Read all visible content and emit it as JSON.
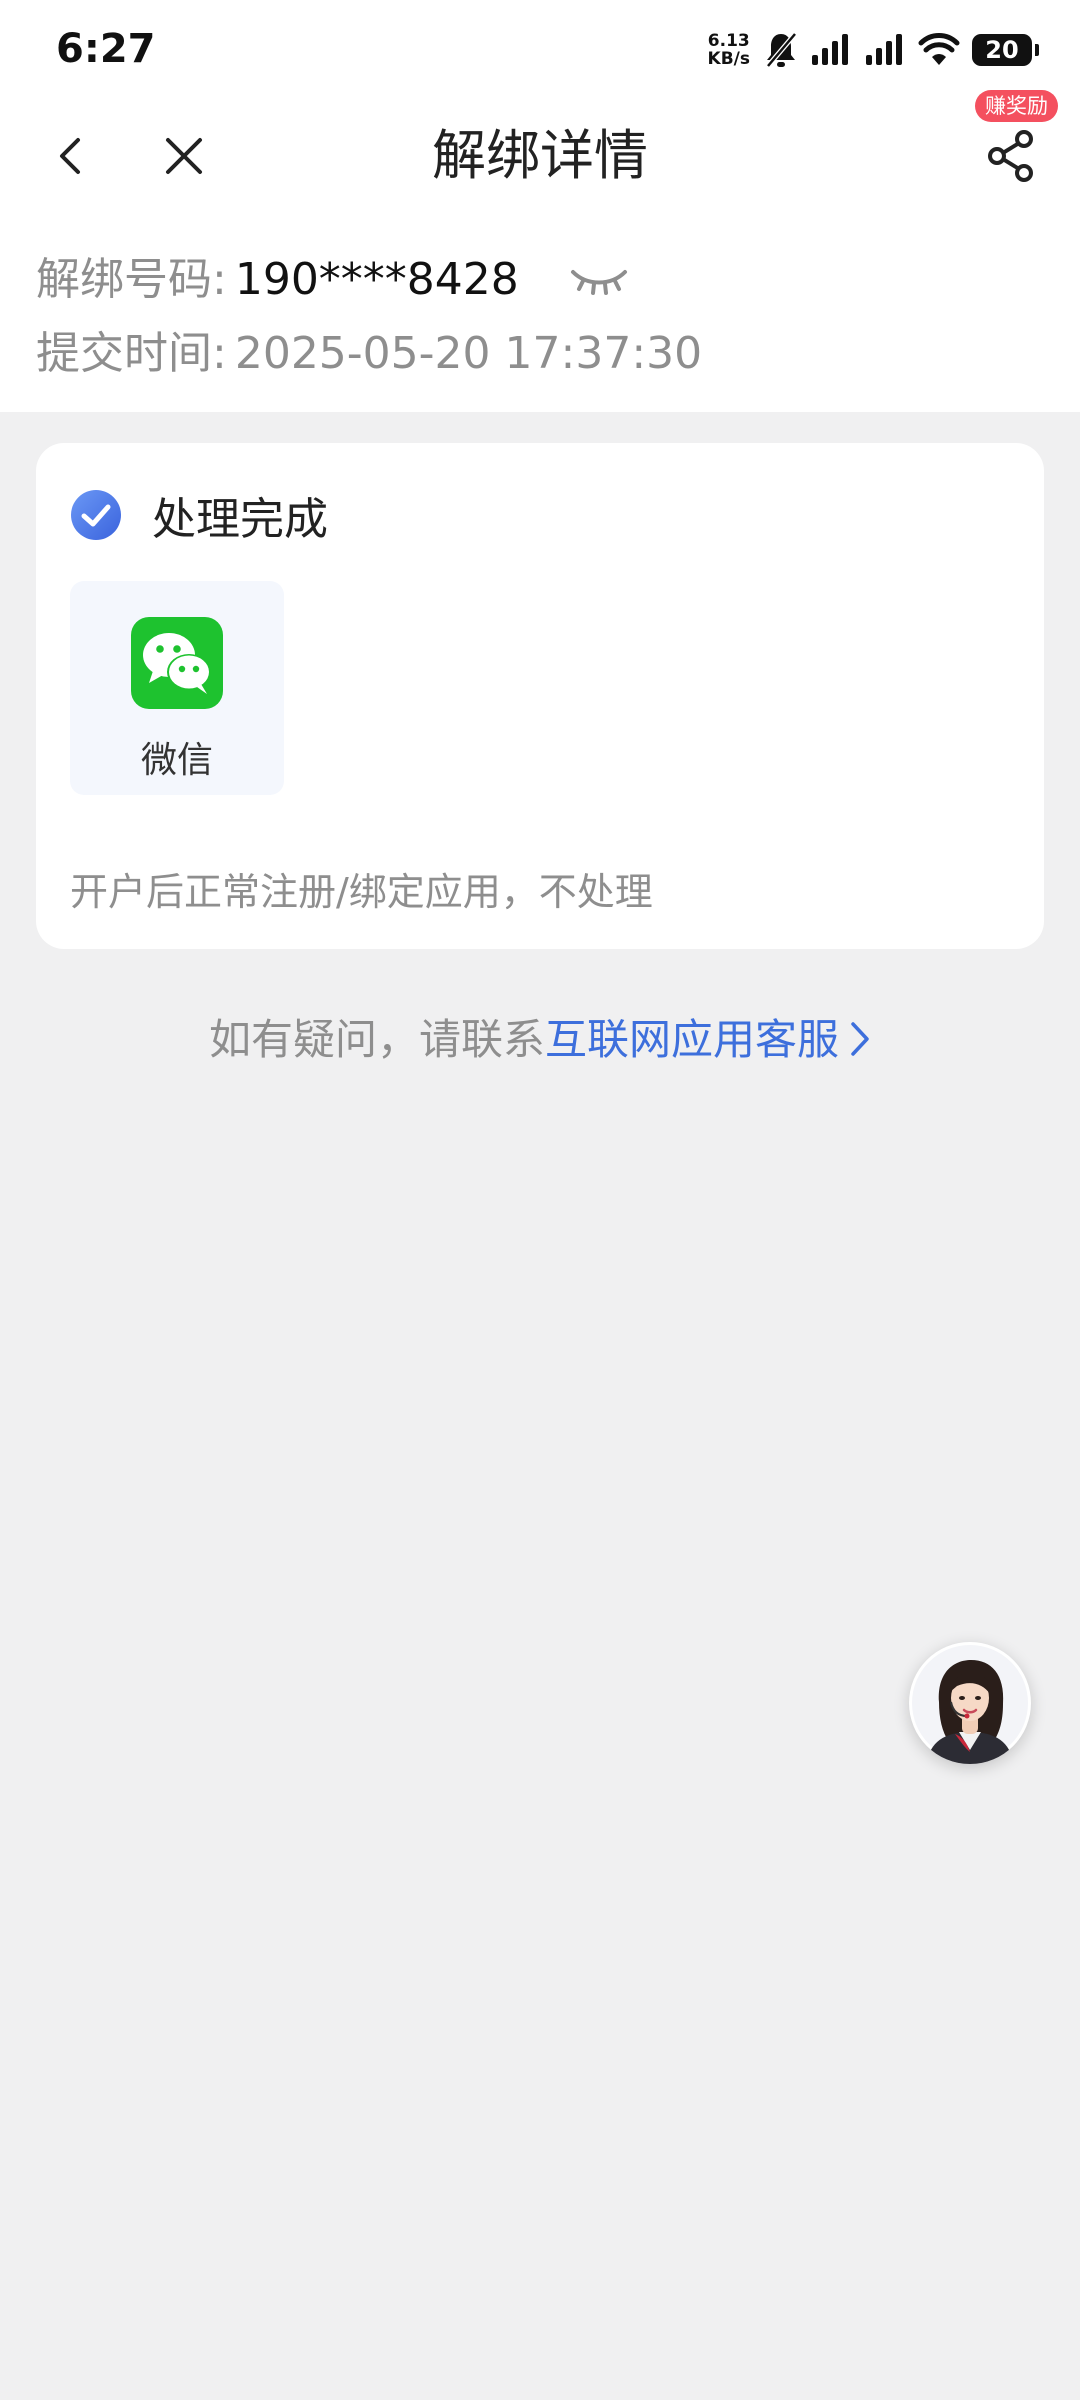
{
  "status_bar": {
    "time": "6:27",
    "net_speed_value": "6.13",
    "net_speed_unit": "KB/s",
    "battery": "20",
    "icons": [
      "mute-bell-icon",
      "signal-icon",
      "signal-icon",
      "wifi-icon",
      "battery-icon"
    ]
  },
  "nav": {
    "title": "解绑详情",
    "reward_badge": "赚奖励",
    "icons": [
      "back-icon",
      "close-icon",
      "share-icon"
    ]
  },
  "info": {
    "number_label": "解绑号码:",
    "number_value": "190****8428",
    "time_label": "提交时间:",
    "time_value": "2025-05-20 17:37:30"
  },
  "card": {
    "status": "处理完成",
    "app_name": "微信",
    "note": "开户后正常注册/绑定应用，不处理"
  },
  "contact": {
    "prefix": "如有疑问，请联系",
    "link": "互联网应用客服"
  },
  "colors": {
    "background": "#f0f0f1",
    "link_blue": "#3d6fdc",
    "badge_red": "#f4505f",
    "check_blue": "#4a7ae8",
    "wechat_green": "#1ec22f"
  }
}
